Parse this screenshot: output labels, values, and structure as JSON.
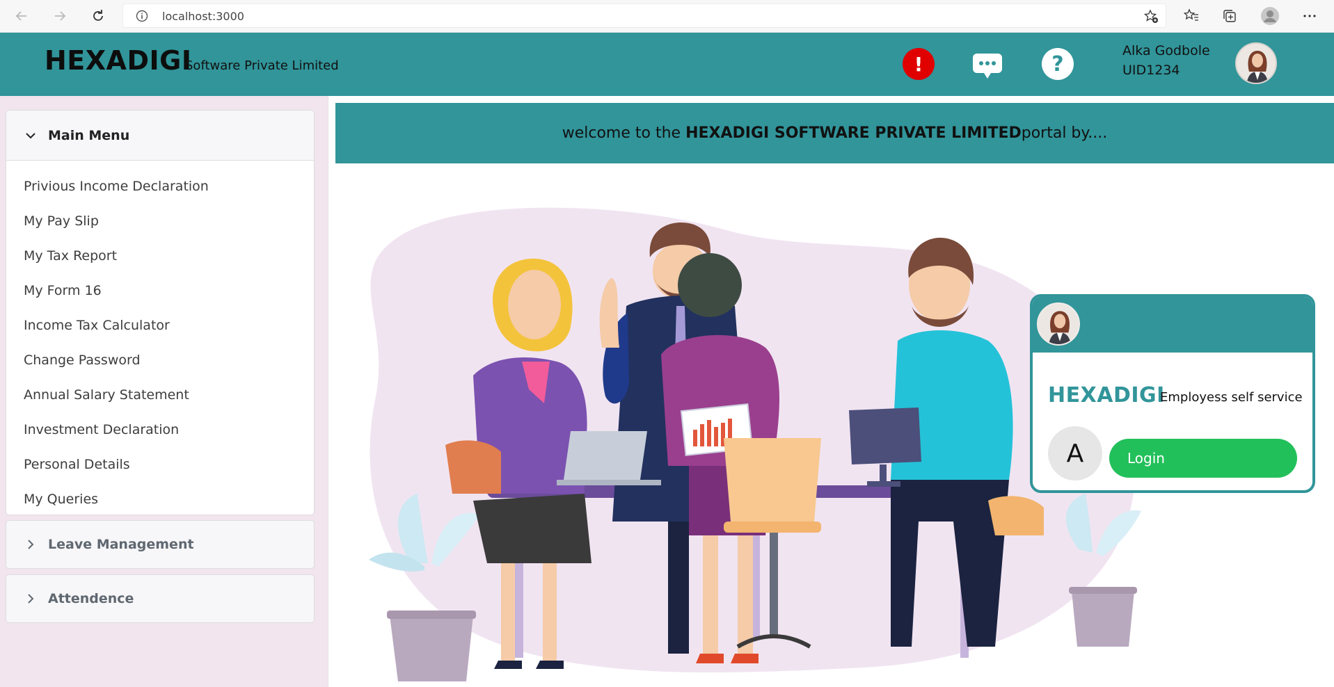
{
  "browser": {
    "url": "localhost:3000",
    "icons": [
      "back-icon",
      "forward-icon",
      "refresh-icon",
      "info-icon",
      "favorite-add-icon",
      "favorites-icon",
      "collections-icon",
      "profile-icon",
      "more-icon"
    ]
  },
  "header": {
    "brand": "HEXADIGI",
    "brand_sub": "Software Private Limited",
    "user_name": "Alka Godbole",
    "user_id": "UID1234",
    "alert_glyph": "!",
    "help_glyph": "?",
    "colors": {
      "teal": "#31959a",
      "alert": "#e00000"
    }
  },
  "sidebar": {
    "main_menu": {
      "title": "Main Menu",
      "items": [
        {
          "label": "Privious Income Declaration"
        },
        {
          "label": "My Pay Slip"
        },
        {
          "label": "My Tax Report"
        },
        {
          "label": "My Form 16"
        },
        {
          "label": "Income Tax Calculator"
        },
        {
          "label": "Change Password"
        },
        {
          "label": "Annual Salary Statement"
        },
        {
          "label": "Investment Declaration"
        },
        {
          "label": "Personal Details"
        },
        {
          "label": "My Queries"
        }
      ]
    },
    "leave": {
      "title": "Leave Management"
    },
    "attendence": {
      "title": "Attendence"
    }
  },
  "main": {
    "welcome_prefix": "welcome to the ",
    "welcome_bold": "HEXADIGI SOFTWARE PRIVATE LIMITED",
    "welcome_suffix": "portal by...."
  },
  "login_card": {
    "brand": "HEXADIGI",
    "subtitle": "Employess self service",
    "avatar_letter": "A",
    "login_label": "Login",
    "button_color": "#22c05a"
  }
}
